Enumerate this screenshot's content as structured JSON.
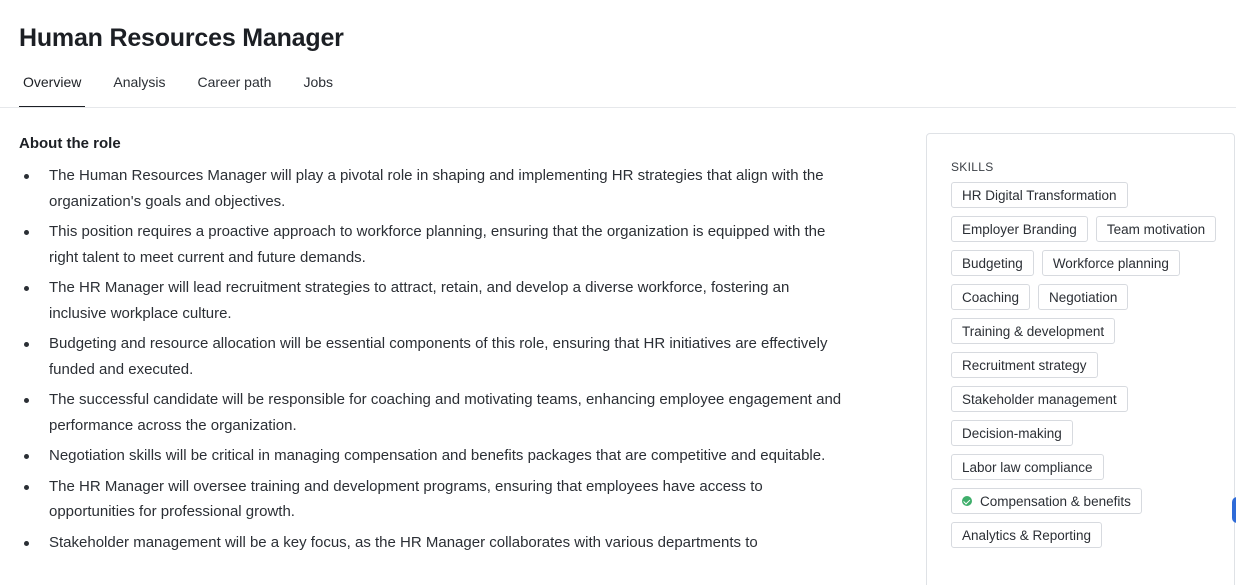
{
  "page": {
    "title": "Human Resources Manager"
  },
  "tabs": [
    {
      "label": "Overview",
      "active": true
    },
    {
      "label": "Analysis",
      "active": false
    },
    {
      "label": "Career path",
      "active": false
    },
    {
      "label": "Jobs",
      "active": false
    }
  ],
  "about": {
    "title": "About the role",
    "items": [
      "The Human Resources Manager will play a pivotal role in shaping and implementing HR strategies that align with the organization's goals and objectives.",
      "This position requires a proactive approach to workforce planning, ensuring that the organization is equipped with the right talent to meet current and future demands.",
      "The HR Manager will lead recruitment strategies to attract, retain, and develop a diverse workforce, fostering an inclusive workplace culture.",
      "Budgeting and resource allocation will be essential components of this role, ensuring that HR initiatives are effectively funded and executed.",
      "The successful candidate will be responsible for coaching and motivating teams, enhancing employee engagement and performance across the organization.",
      "Negotiation skills will be critical in managing compensation and benefits packages that are competitive and equitable.",
      "The HR Manager will oversee training and development programs, ensuring that employees have access to opportunities for professional growth.",
      "Stakeholder management will be a key focus, as the HR Manager collaborates with various departments to"
    ]
  },
  "skills": {
    "label": "SKILLS",
    "chips": [
      {
        "label": "HR Digital Transformation"
      },
      {
        "label": "Employer Branding"
      },
      {
        "label": "Team motivation"
      },
      {
        "label": "Budgeting"
      },
      {
        "label": "Workforce planning"
      },
      {
        "label": "Coaching"
      },
      {
        "label": "Negotiation"
      },
      {
        "label": "Training & development"
      },
      {
        "label": "Recruitment strategy"
      },
      {
        "label": "Stakeholder management"
      },
      {
        "label": "Decision-making"
      },
      {
        "label": "Labor law compliance"
      },
      {
        "label": "Compensation & benefits",
        "verified": true,
        "icon": "check-circle-icon",
        "icon_color": "#3fae6b"
      },
      {
        "label": "Analytics & Reporting"
      }
    ]
  },
  "colors": {
    "accent": "#2f6bd8",
    "verified": "#3fae6b"
  }
}
